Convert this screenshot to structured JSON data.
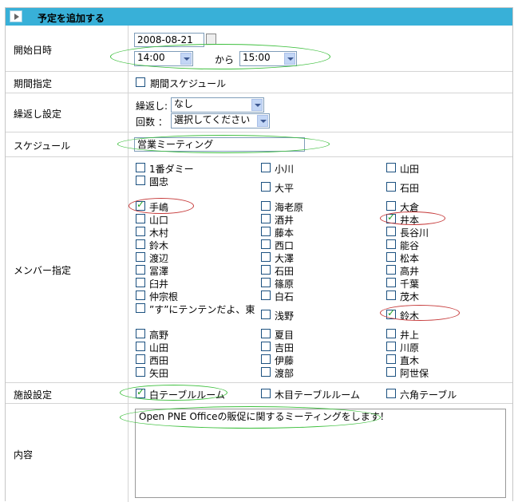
{
  "title": "予定を追加する",
  "labels": {
    "start": "開始日時",
    "period": "期間指定",
    "repeat": "繰返し設定",
    "schedule": "スケジュール",
    "members": "メンバー指定",
    "facility": "施設設定",
    "content": "内容"
  },
  "start": {
    "date": "2008-08-21",
    "from_time": "14:00",
    "kara": "から",
    "to_time": "15:00"
  },
  "period": {
    "checkbox_label": "期間スケジュール",
    "checked": false
  },
  "repeat": {
    "repeat_label": "繰返し:",
    "repeat_value": "なし",
    "count_label": "回数 ：",
    "count_value": "選択してください"
  },
  "schedule": {
    "value": "営業ミーティング"
  },
  "members": [
    [
      {
        "name": "1番ダミー",
        "checked": false
      },
      {
        "name": "國忠",
        "checked": false
      },
      {
        "name": "手嶋",
        "checked": true
      },
      {
        "name": "山口",
        "checked": false
      },
      {
        "name": "木村",
        "checked": false
      },
      {
        "name": "鈴木",
        "checked": false
      },
      {
        "name": "渡辺",
        "checked": false
      },
      {
        "name": "冨澤",
        "checked": false
      },
      {
        "name": "臼井",
        "checked": false
      },
      {
        "name": "仲宗根",
        "checked": false
      },
      {
        "name": "”す”にテンテンだよ、東",
        "checked": false
      },
      {
        "name": "高野",
        "checked": false
      },
      {
        "name": "山田",
        "checked": false
      },
      {
        "name": "西田",
        "checked": false
      },
      {
        "name": "矢田",
        "checked": false
      }
    ],
    [
      {
        "name": "小川",
        "checked": false
      },
      {
        "name": "大平",
        "checked": false
      },
      {
        "name": "海老原",
        "checked": false
      },
      {
        "name": "酒井",
        "checked": false
      },
      {
        "name": "藤本",
        "checked": false
      },
      {
        "name": "西口",
        "checked": false
      },
      {
        "name": "大澤",
        "checked": false
      },
      {
        "name": "石田",
        "checked": false
      },
      {
        "name": "篠原",
        "checked": false
      },
      {
        "name": "白石",
        "checked": false
      },
      {
        "name": "浅野",
        "checked": false
      },
      {
        "name": "夏目",
        "checked": false
      },
      {
        "name": "吉田",
        "checked": false
      },
      {
        "name": "伊藤",
        "checked": false
      },
      {
        "name": "渡部",
        "checked": false
      }
    ],
    [
      {
        "name": "山田",
        "checked": false
      },
      {
        "name": "石田",
        "checked": false
      },
      {
        "name": "大倉",
        "checked": false
      },
      {
        "name": "井本",
        "checked": true
      },
      {
        "name": "長谷川",
        "checked": false
      },
      {
        "name": "能谷",
        "checked": false
      },
      {
        "name": "松本",
        "checked": false
      },
      {
        "name": "高井",
        "checked": false
      },
      {
        "name": "千葉",
        "checked": false
      },
      {
        "name": "茂木",
        "checked": false
      },
      {
        "name": "鈴木",
        "checked": true
      },
      {
        "name": "井上",
        "checked": false
      },
      {
        "name": "川原",
        "checked": false
      },
      {
        "name": "直木",
        "checked": false
      },
      {
        "name": "阿世保",
        "checked": false
      }
    ]
  ],
  "facility": [
    {
      "name": "白テーブルルーム",
      "checked": true
    },
    {
      "name": "木目テーブルルーム",
      "checked": false
    },
    {
      "name": "六角テーブル",
      "checked": false
    }
  ],
  "content": {
    "value": "Open PNE Officeの販促に関するミーティングをします！"
  }
}
